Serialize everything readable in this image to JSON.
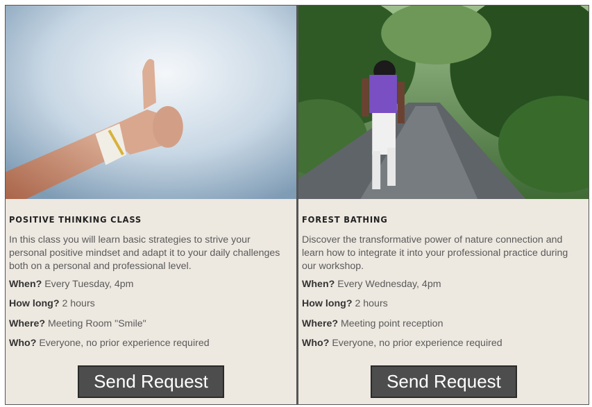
{
  "cards": [
    {
      "image_alt": "thumbs-up-photo",
      "title": "POSITIVE THINKING CLASS",
      "description": "In this class you will learn basic strategies to strive your personal positive mindset and adapt it to your daily challenges both on a personal and professional level.",
      "when_label": "When?",
      "when_value": " Every Tuesday, 4pm",
      "howlong_label": "How long?",
      "howlong_value": " 2 hours",
      "where_label": "Where?",
      "where_value": " Meeting Room \"Smile\"",
      "who_label": "Who?",
      "who_value": " Everyone, no prior experience required",
      "button_label": "Send Request"
    },
    {
      "image_alt": "forest-path-photo",
      "title": "FOREST BATHING",
      "description": "Discover the transformative power of nature connection and learn how to integrate it into your professional practice during our workshop.",
      "when_label": "When?",
      "when_value": " Every Wednesday, 4pm",
      "howlong_label": "How long?",
      "howlong_value": " 2 hours",
      "where_label": "Where?",
      "where_value": " Meeting point reception",
      "who_label": "Who?",
      "who_value": " Everyone, no prior experience required",
      "button_label": "Send Request"
    }
  ],
  "colors": {
    "card_background": "#ede8e0",
    "button_background": "#4d4d4d",
    "button_text": "#ffffff",
    "border": "#555555"
  }
}
